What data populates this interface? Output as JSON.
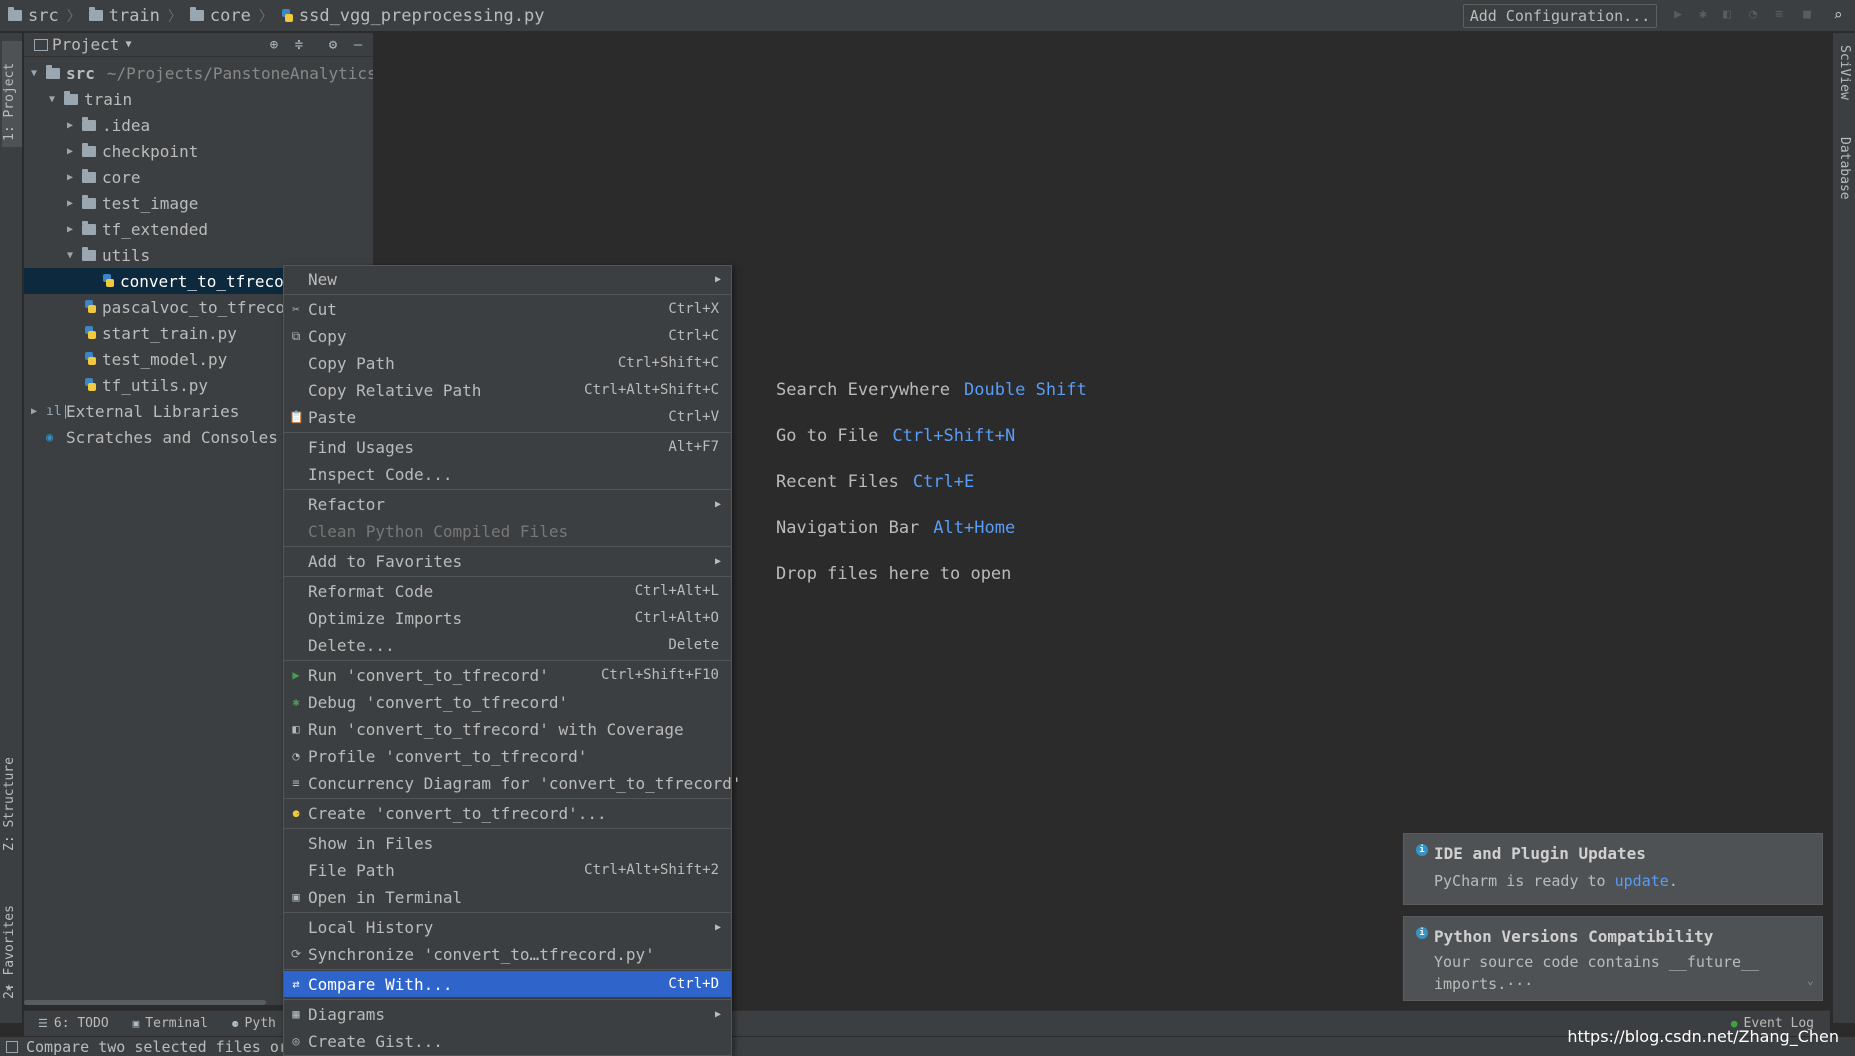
{
  "breadcrumb": {
    "items": [
      "src",
      "train",
      "core"
    ],
    "file": "ssd_vgg_preprocessing.py"
  },
  "toolbar": {
    "add_configuration": "Add Configuration..."
  },
  "left_tabs": {
    "project": "1: Project",
    "structure": "Z: Structure",
    "favorites": "2: Favorites"
  },
  "right_tabs": {
    "sciview": "SciView",
    "database": "Database"
  },
  "project_panel": {
    "title": "Project",
    "tree": {
      "src": "src",
      "src_path": "~/Projects/PanstoneAnalytics/F",
      "train": "train",
      "idea": ".idea",
      "checkpoint": "checkpoint",
      "core": "core",
      "test_image": "test_image",
      "tf_extended": "tf_extended",
      "utils": "utils",
      "convert": "convert_to_tfrecord",
      "pascalvoc": "pascalvoc_to_tfrecord",
      "start_train": "start_train.py",
      "test_model": "test_model.py",
      "tf_utils": "tf_utils.py",
      "external_libraries": "External Libraries",
      "scratches": "Scratches and Consoles"
    }
  },
  "editor_hints": [
    {
      "label": "Search Everywhere",
      "key": "Double Shift"
    },
    {
      "label": "Go to File",
      "key": "Ctrl+Shift+N"
    },
    {
      "label": "Recent Files",
      "key": "Ctrl+E"
    },
    {
      "label": "Navigation Bar",
      "key": "Alt+Home"
    },
    {
      "label": "Drop files here to open",
      "key": ""
    }
  ],
  "context_menu": {
    "new": {
      "label": "New"
    },
    "cut": {
      "label": "Cut",
      "shortcut": "Ctrl+X"
    },
    "copy": {
      "label": "Copy",
      "shortcut": "Ctrl+C"
    },
    "copy_path": {
      "label": "Copy Path",
      "shortcut": "Ctrl+Shift+C"
    },
    "copy_relative_path": {
      "label": "Copy Relative Path",
      "shortcut": "Ctrl+Alt+Shift+C"
    },
    "paste": {
      "label": "Paste",
      "shortcut": "Ctrl+V"
    },
    "find_usages": {
      "label": "Find Usages",
      "shortcut": "Alt+F7"
    },
    "inspect_code": {
      "label": "Inspect Code..."
    },
    "refactor": {
      "label": "Refactor"
    },
    "clean_python": {
      "label": "Clean Python Compiled Files"
    },
    "add_to_favorites": {
      "label": "Add to Favorites"
    },
    "reformat_code": {
      "label": "Reformat Code",
      "shortcut": "Ctrl+Alt+L"
    },
    "optimize_imports": {
      "label": "Optimize Imports",
      "shortcut": "Ctrl+Alt+O"
    },
    "delete": {
      "label": "Delete...",
      "shortcut": "Delete"
    },
    "run": {
      "label": "Run 'convert_to_tfrecord'",
      "shortcut": "Ctrl+Shift+F10"
    },
    "debug": {
      "label": "Debug 'convert_to_tfrecord'"
    },
    "run_coverage": {
      "label": "Run 'convert_to_tfrecord' with Coverage"
    },
    "profile": {
      "label": "Profile 'convert_to_tfrecord'"
    },
    "concurrency": {
      "label": "Concurrency Diagram for 'convert_to_tfrecord'"
    },
    "create": {
      "label": "Create 'convert_to_tfrecord'..."
    },
    "show_in_files": {
      "label": "Show in Files"
    },
    "file_path": {
      "label": "File Path",
      "shortcut": "Ctrl+Alt+Shift+2"
    },
    "open_in_terminal": {
      "label": "Open in Terminal"
    },
    "local_history": {
      "label": "Local History"
    },
    "synchronize": {
      "label": "Synchronize 'convert_to…tfrecord.py'"
    },
    "compare_with": {
      "label": "Compare With...",
      "shortcut": "Ctrl+D"
    },
    "diagrams": {
      "label": "Diagrams"
    },
    "create_gist": {
      "label": "Create Gist..."
    }
  },
  "notifications": [
    {
      "title": "IDE and Plugin Updates",
      "body_prefix": "PyCharm is ready to ",
      "link": "update",
      "body_suffix": "."
    },
    {
      "title": "Python Versions Compatibility",
      "line1": "Your source code contains __future__",
      "line2": "imports.···"
    }
  ],
  "bottom_tools": {
    "todo": "6: TODO",
    "terminal": "Terminal",
    "python": "Pyth",
    "event_log": "Event Log"
  },
  "status_bar": {
    "text": "Compare two selected files or",
    "watermark": "https://blog.csdn.net/Zhang_Chen"
  },
  "colors": {
    "background": "#2b2b2b",
    "panel": "#3c3f41",
    "selection": "#2f65ca",
    "tree_selection": "#0d293e",
    "shortcut_blue": "#589df6"
  }
}
